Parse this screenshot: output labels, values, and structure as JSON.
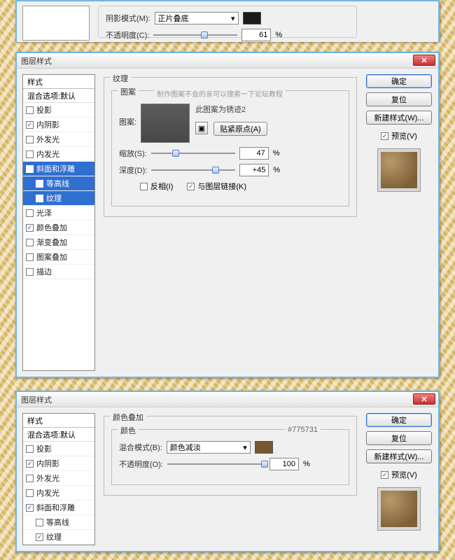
{
  "fragment": {
    "shadow_mode_label": "阴影模式(M):",
    "shadow_mode_value": "正片叠底",
    "opacity_label": "不透明度(C):",
    "opacity_value": "61",
    "opacity_unit": "%"
  },
  "dialog2": {
    "title": "图层样式",
    "styles_header": "样式",
    "blend_options": "混合选项:默认",
    "items": [
      {
        "label": "投影",
        "checked": false,
        "indent": false,
        "sel": false
      },
      {
        "label": "内阴影",
        "checked": true,
        "indent": false,
        "sel": false
      },
      {
        "label": "外发光",
        "checked": false,
        "indent": false,
        "sel": false
      },
      {
        "label": "内发光",
        "checked": false,
        "indent": false,
        "sel": false
      },
      {
        "label": "斜面和浮雕",
        "checked": true,
        "indent": false,
        "sel": true
      },
      {
        "label": "等高线",
        "checked": false,
        "indent": true,
        "sel": true
      },
      {
        "label": "纹理",
        "checked": true,
        "indent": true,
        "sel": true
      },
      {
        "label": "光泽",
        "checked": false,
        "indent": false,
        "sel": false
      },
      {
        "label": "颜色叠加",
        "checked": true,
        "indent": false,
        "sel": false
      },
      {
        "label": "渐变叠加",
        "checked": false,
        "indent": false,
        "sel": false
      },
      {
        "label": "图案叠加",
        "checked": false,
        "indent": false,
        "sel": false
      },
      {
        "label": "描边",
        "checked": false,
        "indent": false,
        "sel": false
      }
    ],
    "texture": {
      "title": "纹理",
      "pattern_group": "图案",
      "hint": "制作图案不会的亲可以搜索一下论坛教程",
      "pattern_label": "图案:",
      "pattern_name": "此图案为锈迹2",
      "snap_btn": "贴紧原点(A)",
      "scale_label": "缩放(S):",
      "scale_value": "47",
      "scale_unit": "%",
      "depth_label": "深度(D):",
      "depth_value": "+45",
      "depth_unit": "%",
      "invert_label": "反相(I)",
      "link_label": "与图层链接(K)"
    },
    "buttons": {
      "ok": "确定",
      "reset": "复位",
      "newstyle": "新建样式(W)...",
      "preview": "预览(V)"
    }
  },
  "dialog3": {
    "title": "图层样式",
    "styles_header": "样式",
    "blend_options": "混合选项:默认",
    "items": [
      {
        "label": "投影",
        "checked": false,
        "indent": false
      },
      {
        "label": "内阴影",
        "checked": true,
        "indent": false
      },
      {
        "label": "外发光",
        "checked": false,
        "indent": false
      },
      {
        "label": "内发光",
        "checked": false,
        "indent": false
      },
      {
        "label": "斜面和浮雕",
        "checked": true,
        "indent": false
      },
      {
        "label": "等高线",
        "checked": false,
        "indent": true
      },
      {
        "label": "纹理",
        "checked": true,
        "indent": true
      }
    ],
    "overlay": {
      "title": "颜色叠加",
      "color_group": "颜色",
      "hex": "#775731",
      "blend_label": "混合模式(B):",
      "blend_value": "颜色减淡",
      "opacity_label": "不透明度(O):",
      "opacity_value": "100",
      "opacity_unit": "%"
    },
    "buttons": {
      "ok": "确定",
      "reset": "复位",
      "newstyle": "新建样式(W)...",
      "preview": "预览(V)"
    }
  }
}
